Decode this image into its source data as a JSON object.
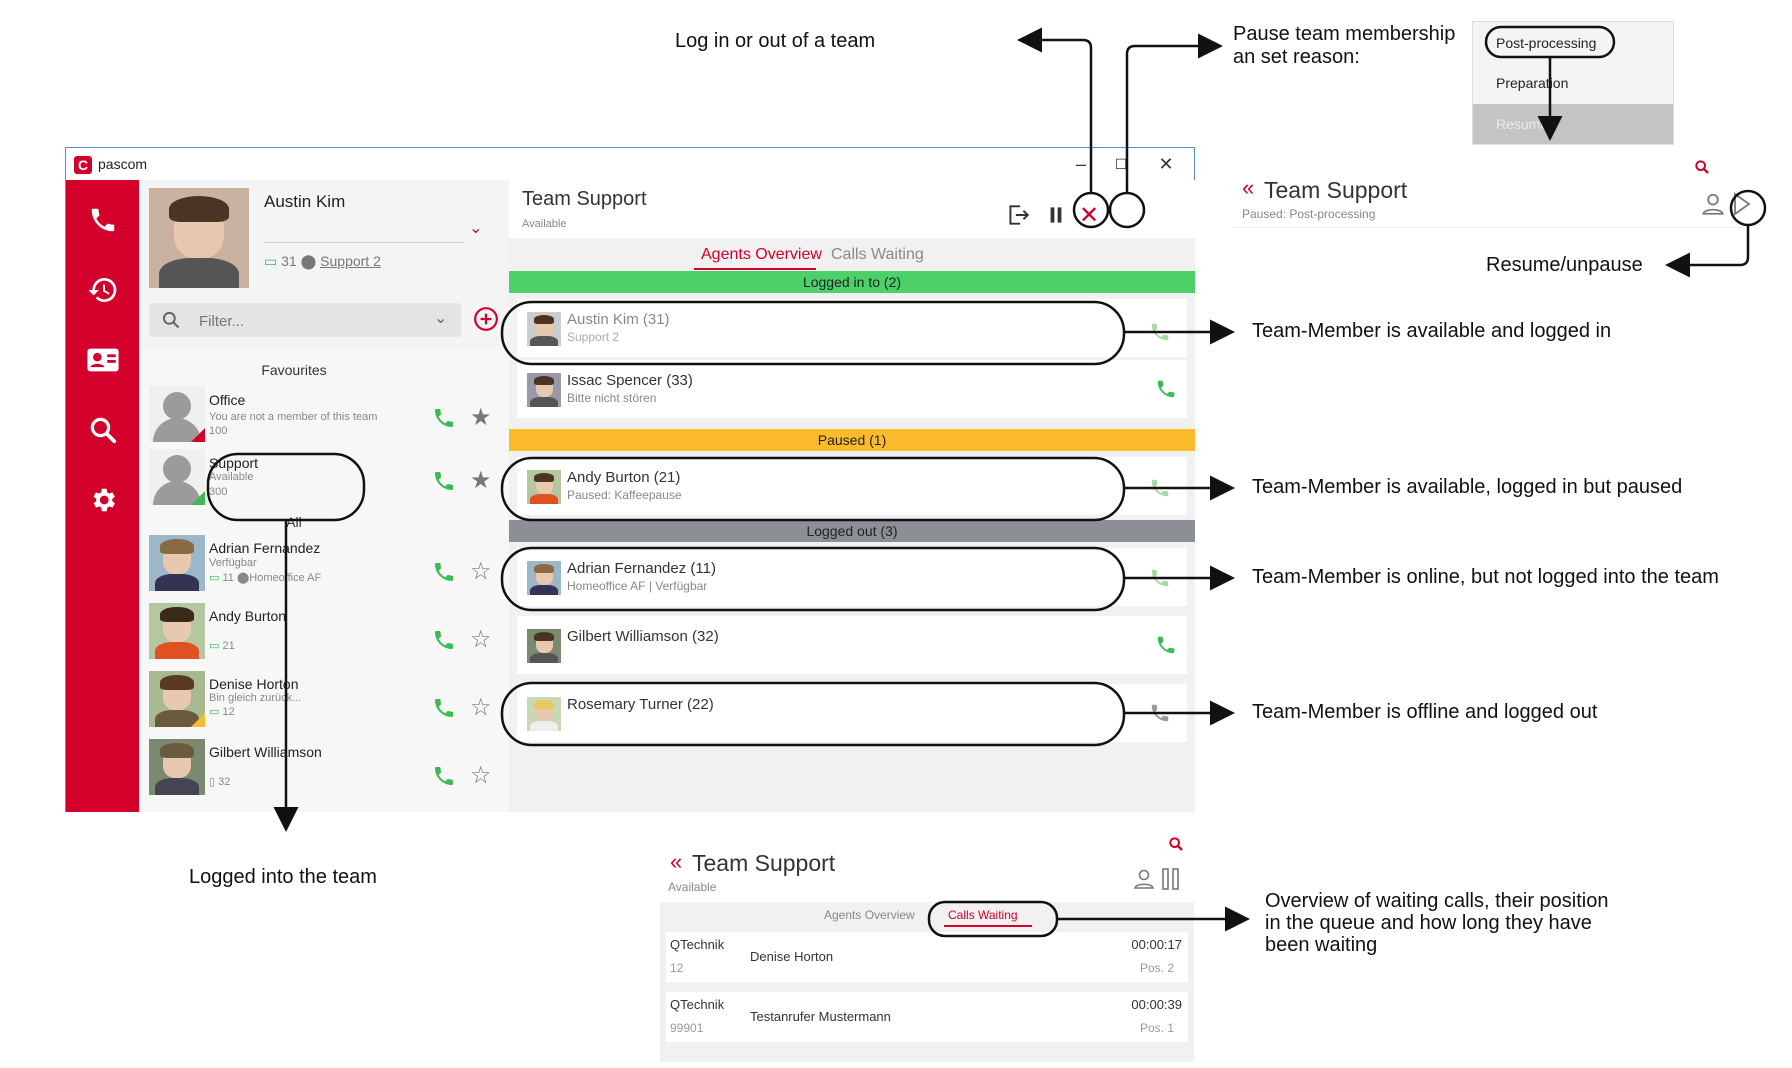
{
  "window": {
    "app_title": "pascom",
    "min_label": "–",
    "max_label": "☐",
    "close_label": "✕"
  },
  "rail": {
    "items": [
      {
        "icon": "phone-icon"
      },
      {
        "icon": "history-icon"
      },
      {
        "icon": "contacts-icon"
      },
      {
        "icon": "search-icon"
      },
      {
        "icon": "gear-icon"
      }
    ]
  },
  "user": {
    "name": "Austin Kim",
    "extension": "31",
    "location": "Support 2"
  },
  "filter": {
    "placeholder": "Filter..."
  },
  "favourites": {
    "header": "Favourites",
    "items": [
      {
        "name": "Office",
        "status": "You are not a member of this team",
        "number": "100"
      },
      {
        "name": "Support",
        "status": "Available",
        "number": "300"
      }
    ]
  },
  "all": {
    "header": "All",
    "items": [
      {
        "name": "Adrian Fernandez",
        "status": "Verfügbar",
        "number": "11",
        "location": "Homeoffice AF"
      },
      {
        "name": "Andy Burton",
        "status": "",
        "number": "21",
        "location": ""
      },
      {
        "name": "Denise Horton",
        "status": "Bin gleich zurück...",
        "number": "12",
        "location": ""
      },
      {
        "name": "Gilbert Williamson",
        "status": "",
        "number": "32",
        "location": ""
      }
    ]
  },
  "team": {
    "title": "Team Support",
    "status": "Available",
    "tabs": [
      "Agents Overview",
      "Calls Waiting"
    ],
    "sections": {
      "logged_in": "Logged in to (2)",
      "paused": "Paused (1)",
      "logged_out": "Logged out (3)"
    },
    "agents": [
      {
        "name": "Austin Kim (31)",
        "status": "Support 2"
      },
      {
        "name": "Issac Spencer (33)",
        "status": "Bitte nicht stören"
      },
      {
        "name": "Andy Burton (21)",
        "status": "Paused: Kaffeepause"
      },
      {
        "name": "Adrian Fernandez (11)",
        "status": "Homeoffice AF |  Verfügbar"
      },
      {
        "name": "Gilbert Williamson (32)",
        "status": ""
      },
      {
        "name": "Rosemary Turner (22)",
        "status": ""
      }
    ]
  },
  "pause_menu": {
    "items": [
      "Post-processing",
      "Preparation",
      "Resume"
    ]
  },
  "paused_panel": {
    "title": "Team Support",
    "status": "Paused: Post-processing"
  },
  "calls_panel": {
    "title": "Team Support",
    "status": "Available",
    "tabs": [
      "Agents Overview",
      "Calls Waiting"
    ],
    "calls": [
      {
        "queue": "QTechnik",
        "number": "12",
        "caller": "Denise Horton",
        "time": "00:00:17",
        "pos": "Pos. 2"
      },
      {
        "queue": "QTechnik",
        "number": "99901",
        "caller": "Testanrufer Mustermann",
        "time": "00:00:39",
        "pos": "Pos. 1"
      }
    ]
  },
  "annotations": {
    "login_team": "Log in or out of a team",
    "pause_team": "Pause team membership\nan set reason:",
    "resume": "Resume/unpause",
    "available_logged_in": "Team-Member is available and logged in",
    "available_paused": "Team-Member is available, logged in but paused",
    "online_not_logged": "Team-Member is online, but not logged into the team",
    "offline_logged_out": "Team-Member is offline and logged out",
    "logged_into_team": "Logged into the team",
    "calls_overview": "Overview of waiting calls, their position\nin the queue and how long they have\nbeen waiting"
  },
  "colors": {
    "brand_red": "#d3002c",
    "green_band": "#4cd068",
    "yellow_band": "#fbbb2a",
    "gray_band": "#8c8f95",
    "phone_green": "#3cba54"
  }
}
